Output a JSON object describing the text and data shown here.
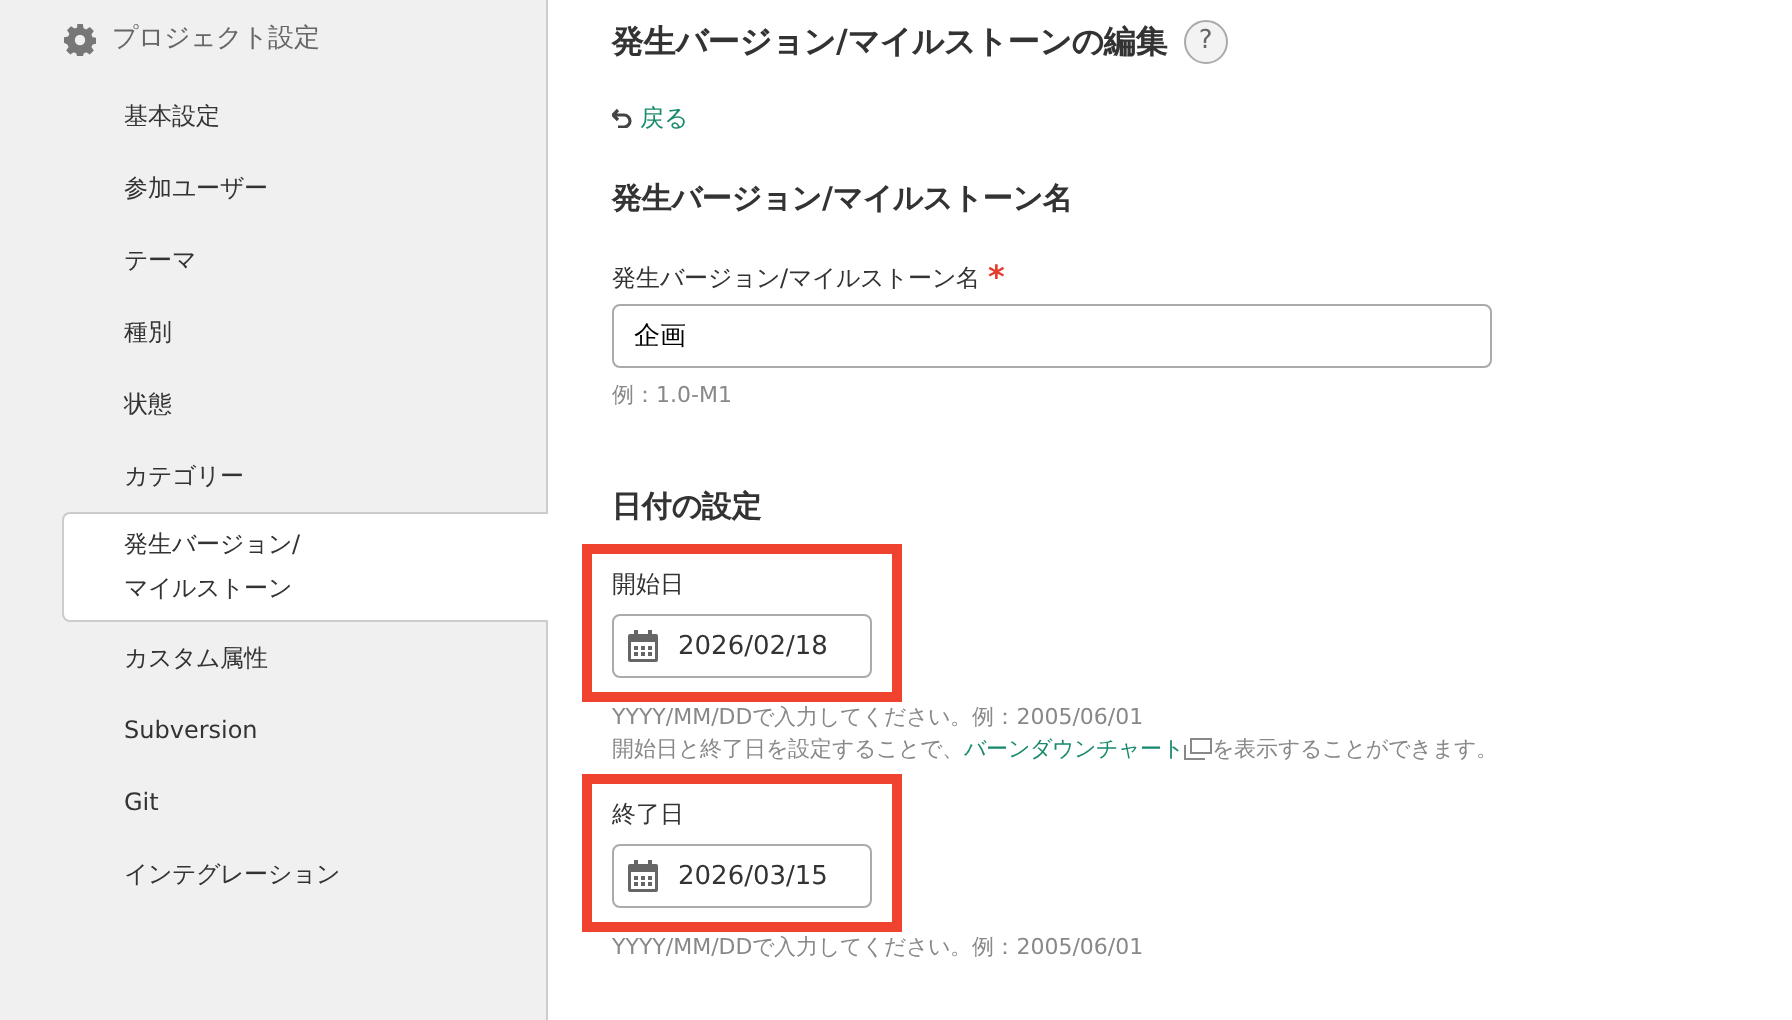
{
  "sidebar": {
    "title": "プロジェクト設定",
    "items": [
      {
        "label": "基本設定",
        "selected": false
      },
      {
        "label": "参加ユーザー",
        "selected": false
      },
      {
        "label": "テーマ",
        "selected": false
      },
      {
        "label": "種別",
        "selected": false
      },
      {
        "label": "状態",
        "selected": false
      },
      {
        "label": "カテゴリー",
        "selected": false
      },
      {
        "label": "発生バージョン/\nマイルストーン",
        "selected": true
      },
      {
        "label": "カスタム属性",
        "selected": false
      },
      {
        "label": "Subversion",
        "selected": false
      },
      {
        "label": "Git",
        "selected": false
      },
      {
        "label": "インテグレーション",
        "selected": false
      }
    ]
  },
  "main": {
    "title": "発生バージョン/マイルストーンの編集",
    "help": "?",
    "back": "戻る",
    "name_section": {
      "heading": "発生バージョン/マイルストーン名",
      "label": "発生バージョン/マイルストーン名",
      "required_mark": "*",
      "value": "企画",
      "hint": "例：1.0-M1"
    },
    "date_section": {
      "heading": "日付の設定",
      "fields": [
        {
          "label": "開始日",
          "value": "2026/02/18",
          "highlighted": true,
          "hints": [
            {
              "text": "YYYY/MM/DDで入力してください。例：2005/06/01"
            },
            {
              "before": "開始日と終了日を設定することで、",
              "link": "バーンダウンチャート",
              "after": "を表示することができます。"
            }
          ]
        },
        {
          "label": "終了日",
          "value": "2026/03/15",
          "highlighted": true,
          "hints": [
            {
              "text": "YYYY/MM/DDで入力してください。例：2005/06/01"
            }
          ]
        }
      ]
    }
  }
}
